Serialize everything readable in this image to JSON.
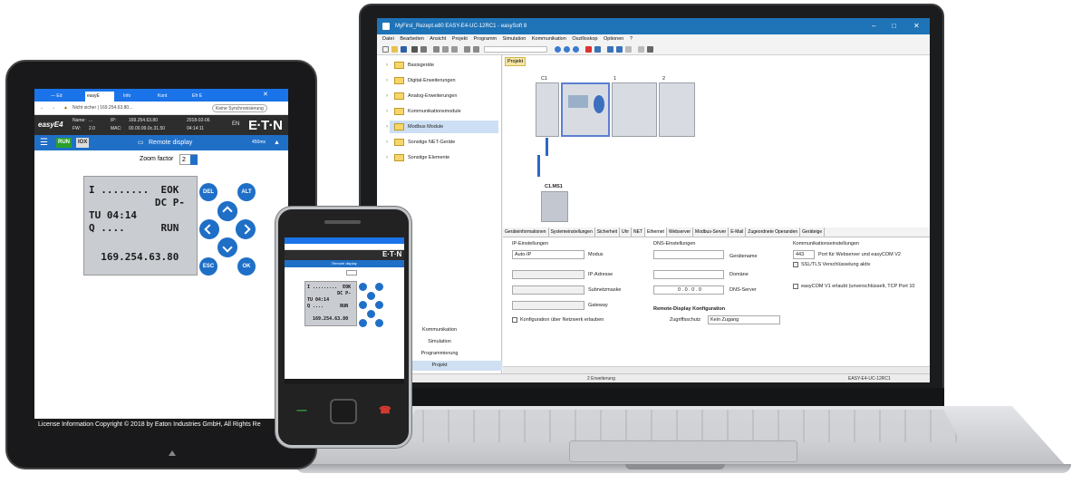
{
  "laptop": {
    "window_title": "MyFirst_Rezept.e80 EASY-E4-UC-12RC1 - easySoft 8",
    "menu": [
      "Datei",
      "Bearbeiten",
      "Ansicht",
      "Projekt",
      "Programm",
      "Simulation",
      "Kommunikation",
      "Oszilloskop",
      "Optionen",
      "?"
    ],
    "tree": [
      "Basisgeräte",
      "Digital-Erweiterungen",
      "Analog-Erweiterungen",
      "Kommunikationsmodule",
      "Modbus Module",
      "Sonstige NET-Geräte",
      "Sonstige Elemente"
    ],
    "tree_selected": "Modbus Module",
    "left_nav": [
      "Kommunikation",
      "Simulation",
      "Programmierung",
      "Projekt"
    ],
    "project_tab": "Projekt",
    "devices": {
      "c1": "C1",
      "one": "1",
      "two": "2",
      "modbus": "C1.MS1"
    },
    "tabs": [
      "Geräteinformationen",
      "Systemeinstellungen",
      "Sicherheit",
      "Uhr",
      "NET",
      "Ethernet",
      "Webserver",
      "Modbus-Server",
      "E-Mail",
      "Zugeordnete Operanden",
      "Geräteige"
    ],
    "active_tab": "Ethernet",
    "ip_section": "IP-Einstellungen",
    "mode_value": "Auto-IP",
    "mode_label": "Modus",
    "ip_label": "IP-Adresse",
    "subnet_label": "Subnetzmaske",
    "gateway_label": "Gateway",
    "config_check": "Konfiguration über Netzwerk erlauben",
    "dns_section": "DNS-Einstellungen",
    "device_name_label": "Gerätename",
    "domain_label": "Domäne",
    "dns_value": "0 . 0 . 0 . 0",
    "dns_label": "DNS-Server",
    "remote_section": "Remote-Display Konfiguration",
    "access_label": "Zugriffsschutz",
    "access_value": "Kein Zugang",
    "comm_section": "Kommunikationseinstellungen",
    "port_value": "443",
    "port_label": "Port für Webserver und easyCOM V2",
    "ssl_label": "SSL/TLS Verschlüsselung aktiv",
    "easycom_label": "easyCOM V1 erlaubt (unverschlüsselt, TCP Port 10",
    "status_left": "2 Erweiterung",
    "status_right": "EASY-E4-UC-12RC1"
  },
  "tablet": {
    "browser_tabs": [
      "— Ed",
      "easyE",
      "Info",
      "Kont",
      "Efr E"
    ],
    "address": "Nicht sicher | 169.254.63.80...",
    "sync_label": "Keine Synchronisierung",
    "logo": "easyE4",
    "name_label": "Name:",
    "name_value": "...",
    "fw_label": "FW:",
    "fw_value": "2.0",
    "ip_label": "IP:",
    "ip_value": "169.254.63.80",
    "mac_label": "MAC:",
    "mac_value": "00.00.99.0c.31.50",
    "date_value": "2018-02-06",
    "time_value": "04:14:11",
    "lang": "EN",
    "eaton_logo": "E·T·N",
    "run_label": "RUN",
    "iox_label": "IOX",
    "title": "Remote display",
    "refresh_rate": "450ms",
    "zoom_label": "Zoom factor",
    "zoom_value": "2",
    "lcd": [
      "I ........  EOK",
      "           DC P-",
      "TU 04:14",
      "Q ....      RUN",
      "",
      "  169.254.63.80"
    ],
    "keys": {
      "del": "DEL",
      "alt": "ALT",
      "esc": "ESC",
      "ok": "OK"
    },
    "footer": "License Information      Copyright © 2018 by Eaton Industries GmbH, All Rights Re"
  },
  "phone": {
    "lcd": [
      "I .........  EOK",
      "           DC P-",
      "TU 04:14",
      "Q ....      RUN",
      "",
      "  169.254.63.80"
    ],
    "title": "Remote display",
    "eaton_logo": "E·T·N"
  }
}
